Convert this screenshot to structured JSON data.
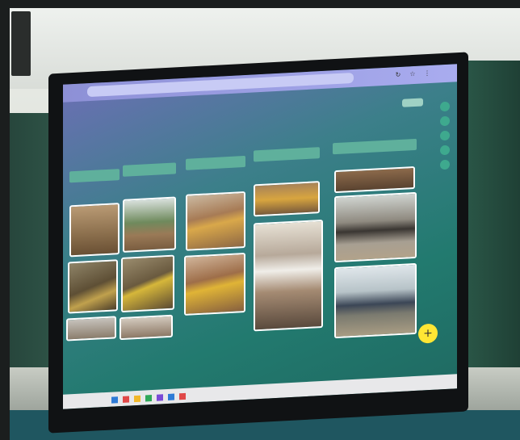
{
  "scene": {
    "description_icons": [
      "speaker-icon",
      "chalk-icon",
      "plus-icon"
    ]
  },
  "screen": {
    "page_title": "",
    "board_name": "",
    "columns": [
      {
        "header": ""
      },
      {
        "header": ""
      },
      {
        "header": ""
      },
      {
        "header": ""
      },
      {
        "header": ""
      }
    ],
    "add_button": "+",
    "browser_icons": [
      "refresh-icon",
      "star-icon",
      "menu-icon"
    ]
  },
  "colors": {
    "screen_accent": "#227a6f",
    "column_header": "#5fb09c",
    "add_button": "#ffe634"
  }
}
